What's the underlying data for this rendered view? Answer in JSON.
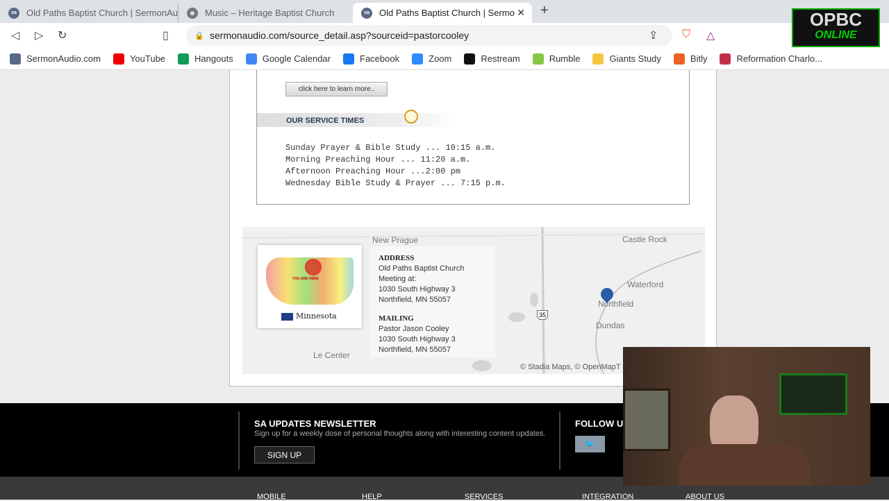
{
  "browser": {
    "tabs": [
      {
        "title": "Old Paths Baptist Church | SermonAu"
      },
      {
        "title": "Music – Heritage Baptist Church"
      },
      {
        "title": "Old Paths Baptist Church | Sermo",
        "active": true
      }
    ],
    "url": "sermonaudio.com/source_detail.asp?sourceid=pastorcooley",
    "bookmarks": [
      {
        "label": "SermonAudio.com",
        "color": "#5a6a85"
      },
      {
        "label": "YouTube",
        "color": "#e00"
      },
      {
        "label": "Hangouts",
        "color": "#0f9d58"
      },
      {
        "label": "Google Calendar",
        "color": "#4285f4"
      },
      {
        "label": "Facebook",
        "color": "#1877f2"
      },
      {
        "label": "Zoom",
        "color": "#2d8cff"
      },
      {
        "label": "Restream",
        "color": "#111"
      },
      {
        "label": "Rumble",
        "color": "#85c742"
      },
      {
        "label": "Giants Study",
        "color": "#f5c542"
      },
      {
        "label": "Bitly",
        "color": "#ee6123"
      },
      {
        "label": "Reformation Charlo...",
        "color": "#c0304a"
      }
    ]
  },
  "overlay": {
    "logo_line1": "OPBC",
    "logo_line2": "ONLINE",
    "logo_color": "#00d000"
  },
  "church": {
    "learn_more": "click here to learn more..",
    "service_times_heading": "OUR SERVICE TIMES",
    "service_times": [
      "Sunday Prayer & Bible Study ... 10:15 a.m.",
      "Morning Preaching Hour ... 11:20 a.m.",
      "Afternoon Preaching Hour ...2:00 pm",
      "Wednesday Bible Study & Prayer ... 7:15 p.m."
    ]
  },
  "map": {
    "labels": [
      "New Prague",
      "Castle Rock",
      "Waterford",
      "Northfield",
      "Dundas",
      "Le Center",
      "35"
    ],
    "attribution": "© Stadia Maps, © OpenMapT",
    "state": "Minnesota",
    "you_are_here": "YOU ARE HERE",
    "address_heading": "ADDRESS",
    "address": [
      "Old Paths Baptist Church",
      "Meeting at:",
      "1030 South Highway 3",
      "Northfield, MN 55057"
    ],
    "mailing_heading": "MAILING",
    "mailing": [
      "Pastor Jason Cooley",
      "1030 South Highway 3",
      "Northfield, MN 55057"
    ]
  },
  "footer": {
    "newsletter_title": "SA UPDATES NEWSLETTER",
    "newsletter_text": "Sign up for a weekly dose of personal thoughts along with interesting content updates.",
    "signup": "SIGN UP",
    "follow": "FOLLOW U",
    "links": [
      "MOBILE",
      "HELP",
      "SERVICES",
      "INTEGRATION",
      "ABOUT US"
    ]
  }
}
